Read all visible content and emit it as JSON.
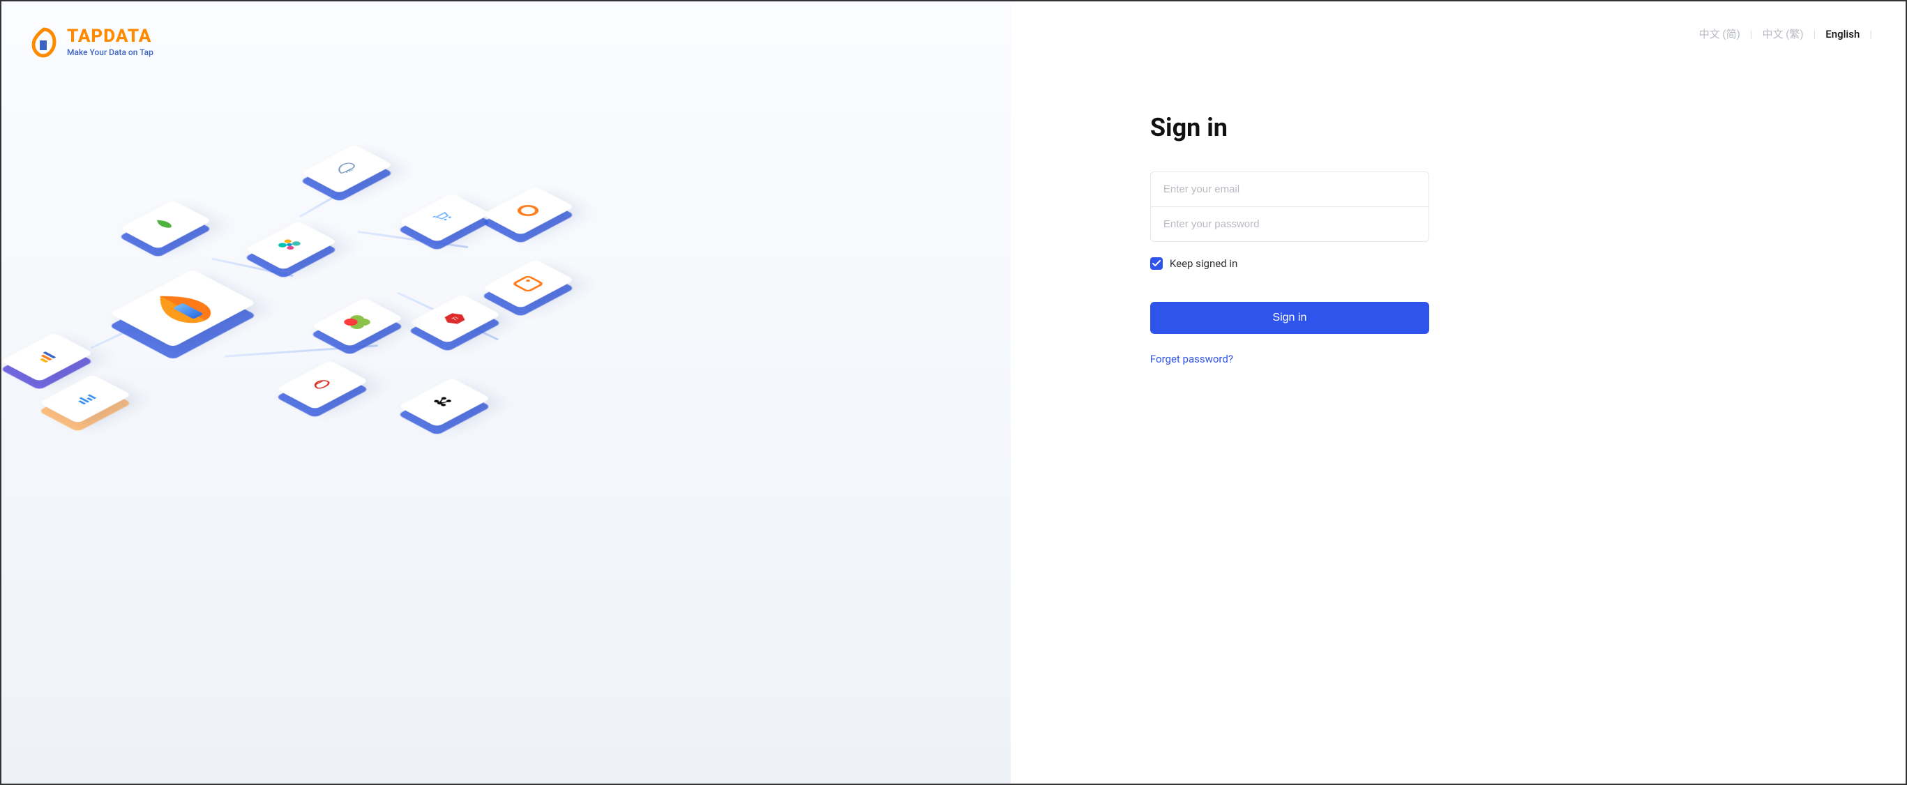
{
  "brand": {
    "name": "TAPDATA",
    "tagline": "Make Your Data on Tap"
  },
  "lang": {
    "zh_simplified": "中文 (简)",
    "zh_traditional": "中文 (繁)",
    "english": "English"
  },
  "signin": {
    "title": "Sign in",
    "email_placeholder": "Enter your email",
    "password_placeholder": "Enter your password",
    "keep_signed_in": "Keep signed in",
    "keep_signed_in_checked": true,
    "submit": "Sign in",
    "forgot": "Forget password?"
  },
  "illustration_icons": {
    "leaf": "mongodb-leaf-icon",
    "elastic": "elasticsearch-icon",
    "pxc": "pxc-dolphin-icon",
    "cart": "shopping-cart-icon",
    "ring": "orange-ring-icon",
    "square": "orange-square-icon",
    "hex": "red-hexagon-icon",
    "flower": "green-flower-icon",
    "redhat": "redhat-icon",
    "kafka": "kafka-icon",
    "bars": "bar-chart-icon",
    "main": "tapdata-drop-icon"
  },
  "colors": {
    "accent": "#2f54eb",
    "brand_orange": "#ff8a00",
    "brand_blue": "#3a63c2"
  }
}
